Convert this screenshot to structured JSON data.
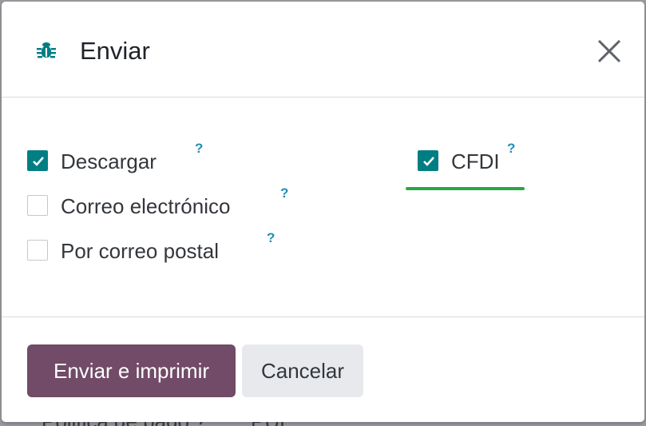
{
  "background": {
    "left_text": "Politica de pago ?",
    "right_text": "PUE"
  },
  "dialog": {
    "title": "Enviar",
    "title_icon": "bug-icon",
    "close_icon": "close-icon"
  },
  "options": [
    {
      "label": "Descargar",
      "checked": true,
      "help": "?"
    },
    {
      "label": "Correo electrónico",
      "checked": false,
      "help": "?"
    },
    {
      "label": "Por correo postal",
      "checked": false,
      "help": "?"
    },
    {
      "label": "CFDI",
      "checked": true,
      "help": "?"
    }
  ],
  "buttons": {
    "primary_label": "Enviar e imprimir",
    "secondary_label": "Cancelar"
  },
  "colors": {
    "brand_primary": "#714b67",
    "checkbox_accent": "#017e84",
    "help_color": "#1f8fb8",
    "highlight_green": "#28a745"
  }
}
